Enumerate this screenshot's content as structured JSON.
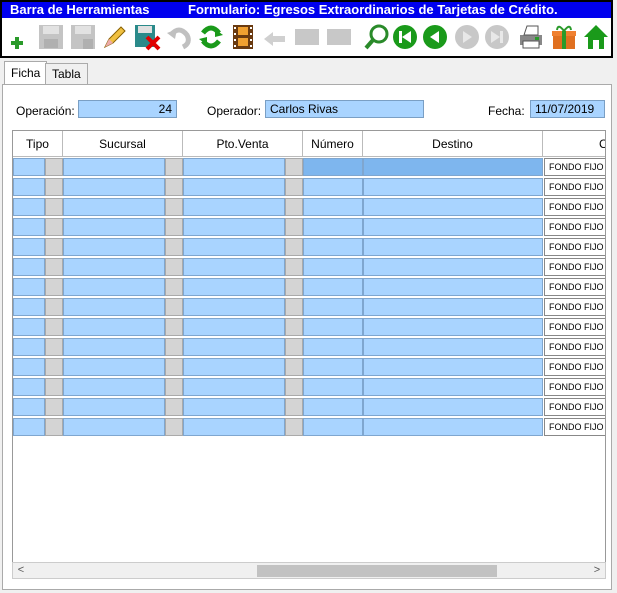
{
  "titlebar": {
    "left": "Barra de Herramientas",
    "right": "Formulario: Egresos Extraordinarios de Tarjetas de Crédito."
  },
  "toolbar": {
    "buttons": [
      "add-icon",
      "save-icon",
      "save-as-icon",
      "edit-icon",
      "delete-save-icon",
      "undo-icon",
      "refresh-icon",
      "film-icon",
      "back-arrow-icon",
      "disabled-icon",
      "disabled-icon",
      "search-icon",
      "first-record-icon",
      "previous-record-icon",
      "next-record-icon",
      "last-record-icon",
      "print-icon",
      "gift-icon",
      "home-icon"
    ]
  },
  "tabs": {
    "ficha": "Ficha",
    "tabla": "Tabla"
  },
  "form": {
    "operacion_label": "Operación:",
    "operacion_value": "24",
    "operador_label": "Operador:",
    "operador_value": "Carlos Rivas",
    "fecha_label": "Fecha:",
    "fecha_value": "11/07/2019"
  },
  "grid": {
    "columns": [
      "Tipo",
      "Sucursal",
      "Pto.Venta",
      "Número",
      "Destino",
      "C"
    ],
    "row_text": "FONDO FIJO",
    "row_count": 14
  },
  "colors": {
    "title_bg": "#0000ee",
    "field_bg": "#a9d4ff"
  }
}
